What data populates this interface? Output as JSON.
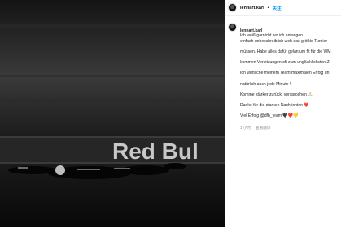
{
  "post": {
    "username": "lennart.karl",
    "separator": "•",
    "follow_label": "关注",
    "caption_lines": [
      "Ich weiß garnicht wo ich anfangen",
      "einfach unbeschreiblich weh das größte Turnier",
      "müssen. Habe alles dafür gelan um fit für die WM",
      "kommen Verletzungen oft zum unglücklichsten Z",
      "Ich wünsche meinem Team maximalen Erfolg un",
      "natürlich auch jede Minute !",
      "Komme stärker zurück, versprochen 🙏🏻",
      "Danke für die starken Nachrichten ❤️",
      "Viel Erfolg @dfb_team 🖤❤️💛"
    ],
    "time_ago": "1 小时",
    "translate_label": "查看翻译"
  },
  "photo": {
    "banner_text": "Red Bul"
  }
}
